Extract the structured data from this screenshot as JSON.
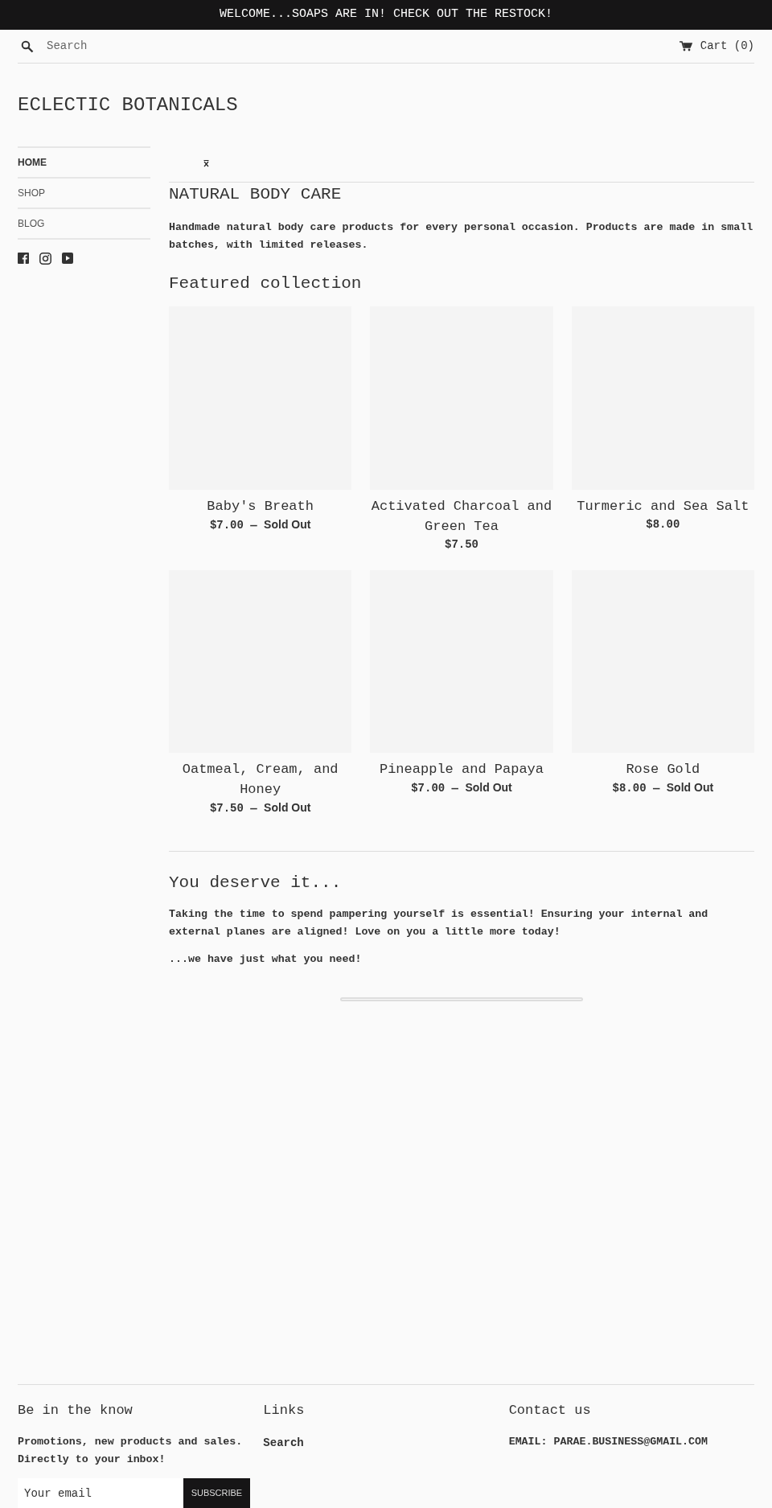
{
  "announcement": "WELCOME...SOAPS ARE IN! CHECK OUT THE RESTOCK!",
  "header": {
    "search": {
      "placeholder": "Search"
    },
    "cart": "Cart (0)"
  },
  "logo": "ECLECTIC BOTANICALS",
  "sidebar": {
    "items": [
      {
        "label": "HOME",
        "selected": true
      },
      {
        "label": "SHOP",
        "selected": false
      },
      {
        "label": "BLOG",
        "selected": false
      }
    ]
  },
  "intro": {
    "title": "NATURAL BODY CARE",
    "text": "Handmade natural body care products for every personal occasion. Products are made in small batches, with limited releases."
  },
  "featured": {
    "title": "Featured collection",
    "products": [
      {
        "name": "Baby's Breath",
        "price": "$7.00",
        "separator": "—",
        "status": "Sold Out"
      },
      {
        "name": "Activated Charcoal and Green Tea",
        "price": "$7.50"
      },
      {
        "name": "Turmeric and Sea Salt",
        "price": "$8.00"
      },
      {
        "name": "Oatmeal, Cream, and Honey",
        "price": "$7.50",
        "separator": "—",
        "status": "Sold Out"
      },
      {
        "name": "Pineapple and Papaya",
        "price": "$7.00",
        "separator": "—",
        "status": "Sold Out"
      },
      {
        "name": "Rose Gold",
        "price": "$8.00",
        "separator": "—",
        "status": "Sold Out"
      }
    ]
  },
  "story": {
    "title": "You deserve it...",
    "paragraphs": [
      "Taking the time to spend pampering yourself is essential! Ensuring your internal and external planes are aligned! Love on you a little more today!",
      "...we have just what you need!"
    ]
  },
  "footer": {
    "columns": [
      {
        "title": "Be in the know",
        "text": "Promotions, new products and sales. Directly to your inbox!",
        "newsletter": {
          "placeholder": "Your email",
          "button": "SUBSCRIBE"
        }
      },
      {
        "title": "Links",
        "links": [
          "Search"
        ]
      },
      {
        "title": "Contact us",
        "text": "EMAIL: PARAE.BUSINESS@GMAIL.COM"
      }
    ]
  }
}
